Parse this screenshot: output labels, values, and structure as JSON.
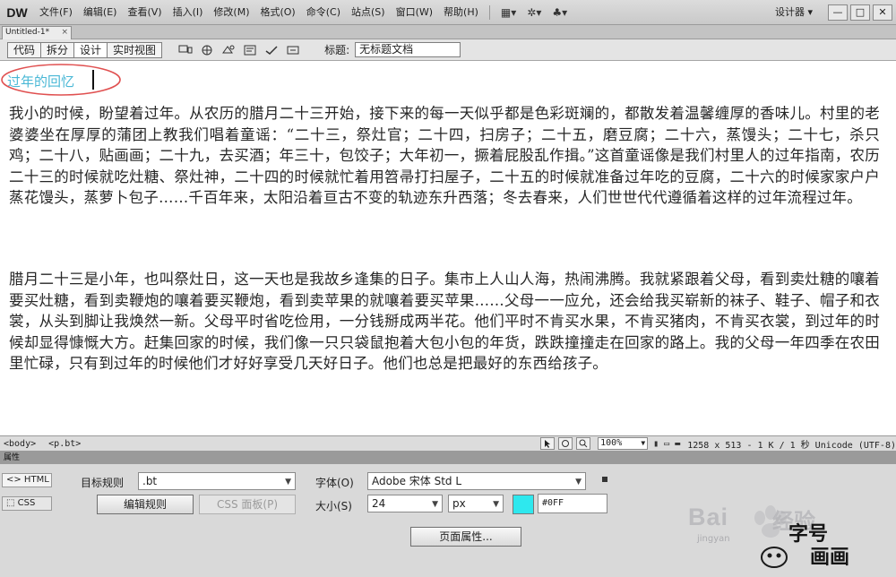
{
  "app": {
    "logo": "DW",
    "menu": [
      "文件(F)",
      "编辑(E)",
      "查看(V)",
      "插入(I)",
      "修改(M)",
      "格式(O)",
      "命令(C)",
      "站点(S)",
      "窗口(W)",
      "帮助(H)"
    ],
    "tools": [
      "▦▾",
      "✲▾",
      "♣▾"
    ],
    "workspace": "设计器 ▾",
    "window_buttons": [
      "—",
      "□",
      "✕"
    ]
  },
  "document": {
    "tab_name": "Untitled-1*",
    "tab_close": "×",
    "views": [
      "代码",
      "拆分",
      "设计",
      "实时视图"
    ],
    "title_label": "标题:",
    "title_value": "无标题文档",
    "heading": "过年的回忆",
    "paragraphs": [
      "我小的时候，盼望着过年。从农历的腊月二十三开始，接下来的每一天似乎都是色彩斑斓的，都散发着温馨缠厚的香味儿。村里的老婆婆坐在厚厚的蒲团上教我们唱着童谣：“二十三，祭灶官；二十四，扫房子；二十五，磨豆腐；二十六，蒸馒头；二十七，杀只鸡；二十八，贴画画；二十九，去买酒；年三十，包饺子；大年初一，撅着屁股乱作揖。”这首童谣像是我们村里人的过年指南，农历二十三的时候就吃灶糖、祭灶神，二十四的时候就忙着用笤帚打扫屋子，二十五的时候就准备过年吃的豆腐，二十六的时候家家户户蒸花馒头，蒸萝卜包子……千百年来，太阳沿着亘古不变的轨迹东升西落；冬去春来，人们世世代代遵循着这样的过年流程过年。",
      "腊月二十三是小年，也叫祭灶日，这一天也是我故乡逢集的日子。集市上人山人海，热闹沸腾。我就紧跟着父母，看到卖灶糖的嚷着要买灶糖，看到卖鞭炮的嚷着要买鞭炮，看到卖苹果的就嚷着要买苹果……父母一一应允，还会给我买崭新的袜子、鞋子、帽子和衣裳，从头到脚让我焕然一新。父母平时省吃俭用，一分钱掰成两半花。他们平时不肯买水果，不肯买猪肉，不肯买衣裳，到过年的时候却显得慷慨大方。赶集回家的时候，我们像一只只袋鼠抱着大包小包的年货，跌跌撞撞走在回家的路上。我的父母一年四季在农田里忙碌，只有到过年的时候他们才好好享受几天好日子。他们也总是把最好的东西给孩子。"
    ]
  },
  "statusbar": {
    "tags": [
      "<body>",
      "<p.bt>"
    ],
    "zoom": "100%",
    "info": "1258 x 513 - 1 K / 1 秒 Unicode (UTF-8)"
  },
  "properties": {
    "header": "属性",
    "mode_html": "<> HTML",
    "mode_css": "⬚ CSS",
    "target_rule_label": "目标规则",
    "target_rule_value": ".bt",
    "edit_rule_button": "编辑规则",
    "css_panel_button": "CSS 面板(P)",
    "font_label": "字体(O)",
    "font_value": "Adobe 宋体 Std L",
    "size_label": "大小(S)",
    "size_value": "24",
    "size_unit": "px",
    "color_hex": "#2ee8ee",
    "color_value": "#0FF",
    "page_props_button": "页面属性..."
  },
  "watermark": {
    "brand": "Bai",
    "brand_suffix": "经验",
    "url": "jingyan",
    "account_line1": "字号",
    "account_line2": "画画"
  }
}
